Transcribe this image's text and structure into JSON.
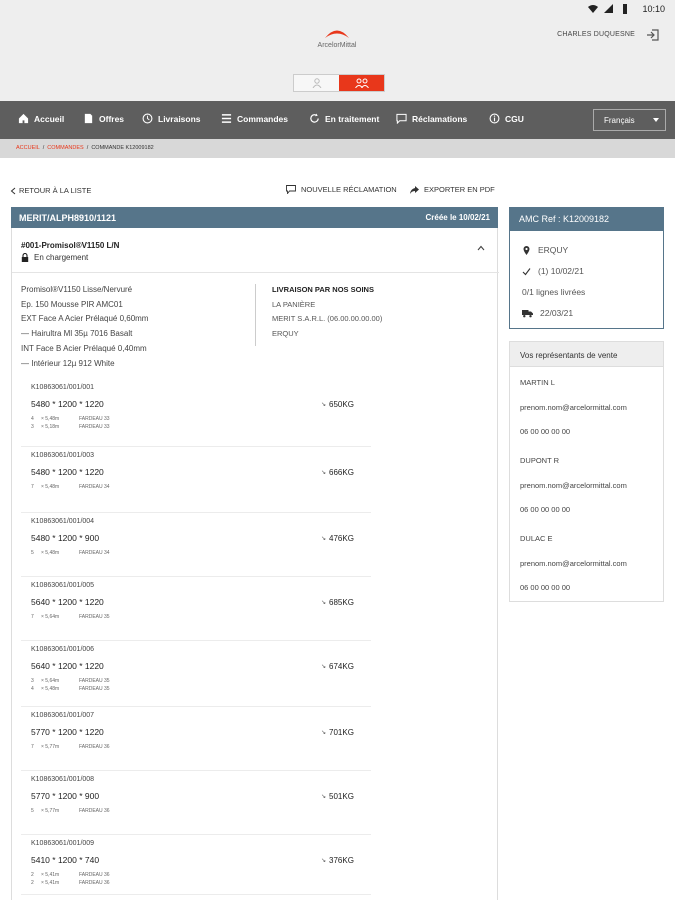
{
  "status_bar": {
    "time": "10:10"
  },
  "header": {
    "logo_text": "ArcelorMittal",
    "user_name": "CHARLES DUQUESNE"
  },
  "nav": {
    "items": [
      {
        "label": "Accueil",
        "icon": "home-icon"
      },
      {
        "label": "Offres",
        "icon": "document-icon"
      },
      {
        "label": "Livraisons",
        "icon": "clock-icon"
      },
      {
        "label": "Commandes",
        "icon": "list-icon"
      },
      {
        "label": "En traitement",
        "icon": "refresh-icon"
      },
      {
        "label": "Réclamations",
        "icon": "chat-icon"
      },
      {
        "label": "CGU",
        "icon": "info-icon"
      }
    ],
    "language": "Français"
  },
  "breadcrumb": {
    "home": "ACCUEIL",
    "sep": "/",
    "orders": "COMMANDES",
    "current": "COMMANDE K12009182"
  },
  "toolbar": {
    "back_label": "RETOUR À LA LISTE",
    "new_claim_label": "NOUVELLE RÉCLAMATION",
    "export_label": "EXPORTER EN PDF"
  },
  "order": {
    "number": "MERIT/ALPH8910/1121",
    "created": "Créée le 10/02/21",
    "product_title": "#001-Promisol®V1150 L/N",
    "status": "En chargement",
    "description": [
      "Promisol®V1150 Lisse/Nervuré",
      "Ep. 150 Mousse PIR AMC01",
      "EXT Face A Acier Prélaqué 0,60mm",
      "— Hairultra Ml 35µ 7016 Basalt",
      "INT Face B Acier Prélaqué 0,40mm",
      "— Intérieur 12µ 912 White"
    ],
    "delivery": {
      "title": "LIVRAISON PAR NOS SOINS",
      "lines": [
        "LA PANIÈRE",
        "MERIT S.A.R.L. (06.00.00.00.00)",
        "ERQUY"
      ]
    },
    "items": [
      {
        "ref": "K10863061/001/001",
        "dims": "5480 * 1200 * 1220",
        "weight": "650KG",
        "packages": [
          {
            "qty": "4",
            "len": "× 5,48m",
            "pkg": "FARDEAU 33"
          },
          {
            "qty": "3",
            "len": "× 5,18m",
            "pkg": "FARDEAU 33"
          }
        ]
      },
      {
        "ref": "K10863061/001/003",
        "dims": "5480 * 1200 * 1220",
        "weight": "666KG",
        "packages": [
          {
            "qty": "7",
            "len": "× 5,48m",
            "pkg": "FARDEAU 34"
          }
        ]
      },
      {
        "ref": "K10863061/001/004",
        "dims": "5480 * 1200 * 900",
        "weight": "476KG",
        "packages": [
          {
            "qty": "5",
            "len": "× 5,48m",
            "pkg": "FARDEAU 34"
          }
        ]
      },
      {
        "ref": "K10863061/001/005",
        "dims": "5640 * 1200 * 1220",
        "weight": "685KG",
        "packages": [
          {
            "qty": "7",
            "len": "× 5,64m",
            "pkg": "FARDEAU 35"
          }
        ]
      },
      {
        "ref": "K10863061/001/006",
        "dims": "5640 * 1200 * 1220",
        "weight": "674KG",
        "packages": [
          {
            "qty": "3",
            "len": "× 5,64m",
            "pkg": "FARDEAU 35"
          },
          {
            "qty": "4",
            "len": "× 5,48m",
            "pkg": "FARDEAU 35"
          }
        ]
      },
      {
        "ref": "K10863061/001/007",
        "dims": "5770 * 1200 * 1220",
        "weight": "701KG",
        "packages": [
          {
            "qty": "7",
            "len": "× 5,77m",
            "pkg": "FARDEAU 36"
          }
        ]
      },
      {
        "ref": "K10863061/001/008",
        "dims": "5770 * 1200 * 900",
        "weight": "501KG",
        "packages": [
          {
            "qty": "5",
            "len": "× 5,77m",
            "pkg": "FARDEAU 36"
          }
        ]
      },
      {
        "ref": "K10863061/001/009",
        "dims": "5410 * 1200 * 740",
        "weight": "376KG",
        "packages": [
          {
            "qty": "2",
            "len": "× 5,41m",
            "pkg": "FARDEAU 36"
          },
          {
            "qty": "2",
            "len": "× 5,41m",
            "pkg": "FARDEAU 36"
          }
        ]
      }
    ]
  },
  "amc": {
    "title": "AMC Ref : K12009182",
    "city": "ERQUY",
    "confirmed": "(1) 10/02/21",
    "lines_delivered": "0/1 lignes livrées",
    "delivery_date": "22/03/21"
  },
  "reps": {
    "title": "Vos représentants de vente",
    "list": [
      {
        "name": "MARTIN L",
        "email": "prenom.nom@arcelormittal.com",
        "phone": "06 00 00 00 00"
      },
      {
        "name": "DUPONT R",
        "email": "prenom.nom@arcelormittal.com",
        "phone": "06 00 00 00 00"
      },
      {
        "name": "DULAC E",
        "email": "prenom.nom@arcelormittal.com",
        "phone": "06 00 00 00 00"
      }
    ]
  },
  "colors": {
    "brand_red": "#e8371b",
    "header_blue": "#56758a",
    "nav_gray": "#5e5e5e"
  }
}
